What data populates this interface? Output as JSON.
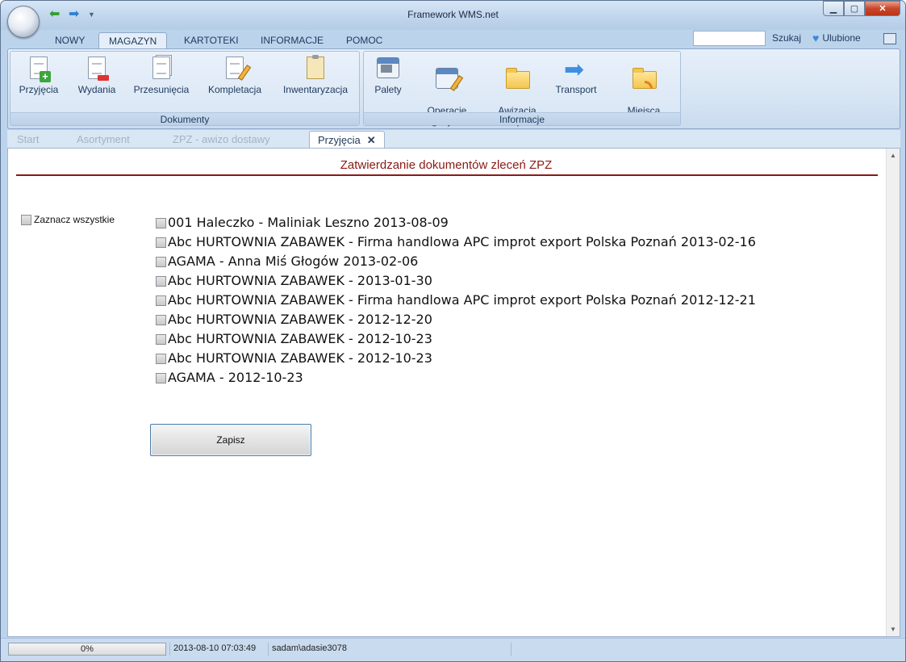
{
  "window": {
    "title": "Framework WMS.net"
  },
  "menu_tabs": [
    "NOWY",
    "MAGAZYN",
    "KARTOTEKI",
    "INFORMACJE",
    "POMOC"
  ],
  "active_menu_tab": "MAGAZYN",
  "search": {
    "label": "Szukaj",
    "value": ""
  },
  "favorites_label": "Ulubione",
  "ribbon": {
    "groups": [
      {
        "label": "Dokumenty",
        "buttons": [
          "Przyjęcia",
          "Wydania",
          "Przesunięcia",
          "Kompletacja",
          "Inwentaryzacja"
        ]
      },
      {
        "label": "Informacje",
        "buttons": [
          "Palety",
          "Operacje\nmagazynowe",
          "Awizacja\ntransportu",
          "Transport",
          "Miejsca\nskładowania"
        ]
      }
    ]
  },
  "doc_tabs": [
    "Start",
    "Asortyment",
    "ZPZ - awizo dostawy",
    "Przyjęcia"
  ],
  "active_doc_tab": "Przyjęcia",
  "page": {
    "heading": "Zatwierdzanie dokumentów zleceń ZPZ",
    "select_all_label": "Zaznacz wszystkie",
    "items": [
      "001 Haleczko - Maliniak Leszno 2013-08-09",
      "Abc HURTOWNIA ZABAWEK - Firma handlowa APC improt export Polska Poznań 2013-02-16",
      "AGAMA - Anna Miś Głogów 2013-02-06",
      "Abc HURTOWNIA ZABAWEK - 2013-01-30",
      "Abc HURTOWNIA ZABAWEK - Firma handlowa APC improt export Polska Poznań 2012-12-21",
      "Abc HURTOWNIA ZABAWEK - 2012-12-20",
      "Abc HURTOWNIA ZABAWEK - 2012-10-23",
      "Abc HURTOWNIA ZABAWEK - 2012-10-23",
      "AGAMA - 2012-10-23"
    ],
    "save_label": "Zapisz"
  },
  "status": {
    "progress": "0%",
    "datetime": "2013-08-10 07:03:49",
    "user": "sadam\\adasie3078"
  },
  "colors": {
    "heading": "#8a1a16",
    "ribbon": "#d4e3f3",
    "accent": "#3f8fe0"
  }
}
